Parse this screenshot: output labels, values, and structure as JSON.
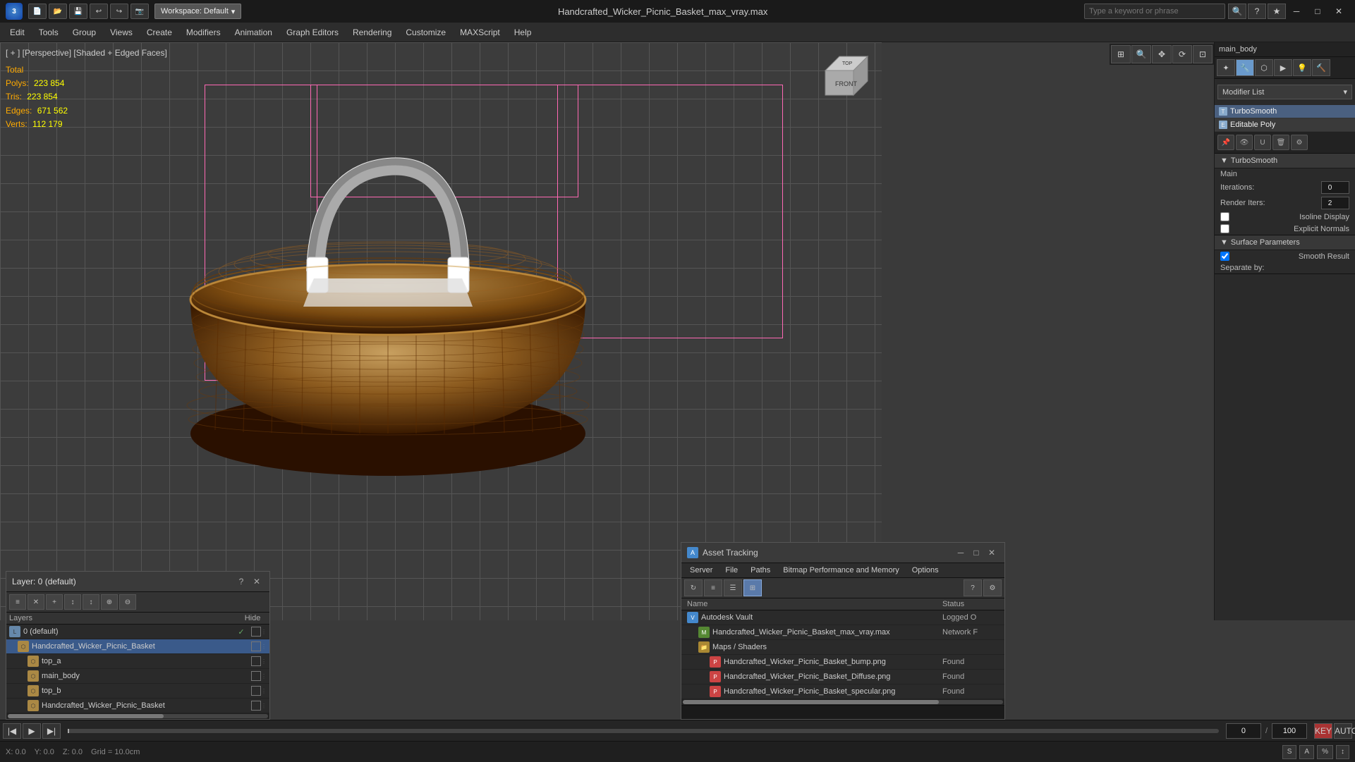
{
  "titlebar": {
    "app_name": "3ds Max",
    "file_title": "Handcrafted_Wicker_Picnic_Basket_max_vray.max",
    "workspace_label": "Workspace: Default",
    "search_placeholder": "Type a keyword or phrase",
    "minimize": "─",
    "maximize": "□",
    "close": "✕"
  },
  "menubar": {
    "items": [
      "Edit",
      "Tools",
      "Group",
      "Views",
      "Create",
      "Modifiers",
      "Animation",
      "Graph Editors",
      "Rendering",
      "Customize",
      "MAXScript",
      "Help"
    ]
  },
  "viewport": {
    "label": "[ + ] [Perspective] [Shaded + Edged Faces]",
    "stats": {
      "polys_label": "Polys:",
      "polys_value": "223 854",
      "tris_label": "Tris:",
      "tris_value": "223 854",
      "edges_label": "Edges:",
      "edges_value": "671 562",
      "verts_label": "Verts:",
      "verts_value": "112 179",
      "total_label": "Total"
    }
  },
  "rightpanel": {
    "modifier_name": "main_body",
    "modifier_list_label": "Modifier List",
    "modifiers": [
      {
        "name": "TurboSmooth",
        "type": "turbosmooth"
      },
      {
        "name": "Editable Poly",
        "type": "editable"
      }
    ],
    "turbosmooth": {
      "title": "TurboSmooth",
      "main_label": "Main",
      "iterations_label": "Iterations:",
      "iterations_value": 0,
      "render_iters_label": "Render Iters:",
      "render_iters_value": 2,
      "isoline_display_label": "Isoline Display",
      "explicit_normals_label": "Explicit Normals"
    },
    "surface_params": {
      "title": "Surface Parameters",
      "smooth_result_label": "Smooth Result",
      "smooth_result_checked": true,
      "separate_by_label": "Separate by:"
    }
  },
  "layerpanel": {
    "title": "Layer: 0 (default)",
    "question_label": "?",
    "headers": {
      "layers_label": "Layers",
      "hide_label": "Hide"
    },
    "layers": [
      {
        "name": "0 (default)",
        "indent": 0,
        "type": "layer",
        "checked": true
      },
      {
        "name": "Handcrafted_Wicker_Picnic_Basket",
        "indent": 1,
        "type": "obj",
        "selected": true
      },
      {
        "name": "top_a",
        "indent": 2,
        "type": "sub"
      },
      {
        "name": "main_body",
        "indent": 2,
        "type": "sub"
      },
      {
        "name": "top_b",
        "indent": 2,
        "type": "sub"
      },
      {
        "name": "Handcrafted_Wicker_Picnic_Basket",
        "indent": 2,
        "type": "sub"
      }
    ]
  },
  "assetpanel": {
    "title": "Asset Tracking",
    "menubar": [
      "Server",
      "File",
      "Paths",
      "Bitmap Performance and Memory",
      "Options"
    ],
    "headers": {
      "name_label": "Name",
      "status_label": "Status"
    },
    "assets": [
      {
        "name": "Autodesk Vault",
        "type": "vault",
        "status": "Logged O",
        "indent": 0
      },
      {
        "name": "Handcrafted_Wicker_Picnic_Basket_max_vray.max",
        "type": "max",
        "status": "Network F",
        "indent": 1
      },
      {
        "name": "Maps / Shaders",
        "type": "folder",
        "status": "",
        "indent": 1
      },
      {
        "name": "Handcrafted_Wicker_Picnic_Basket_bump.png",
        "type": "png",
        "status": "Found",
        "indent": 2
      },
      {
        "name": "Handcrafted_Wicker_Picnic_Basket_Diffuse.png",
        "type": "png",
        "status": "Found",
        "indent": 2
      },
      {
        "name": "Handcrafted_Wicker_Picnic_Basket_specular.png",
        "type": "png",
        "status": "Found",
        "indent": 2
      }
    ]
  },
  "statusbar": {
    "coord_x": "X: 0.0",
    "coord_y": "Y: 0.0",
    "coord_z": "Z: 0.0",
    "grid": "Grid = 10.0cm"
  },
  "animbar": {
    "frame_label": "0/100"
  }
}
